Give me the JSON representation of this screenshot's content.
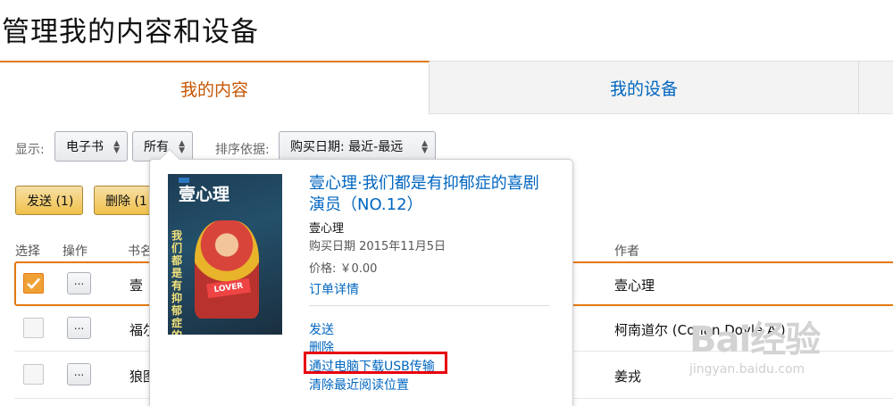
{
  "page_title": "管理我的内容和设备",
  "tabs": [
    {
      "label": "我的内容",
      "active": true
    },
    {
      "label": "我的设备",
      "active": false
    }
  ],
  "filters": {
    "show_label": "显示:",
    "type_value": "电子书",
    "scope_value": "所有",
    "sort_label": "排序依据:",
    "sort_value": "购买日期: 最近-最远"
  },
  "actions": {
    "send_label": "发送 (1)",
    "delete_label": "删除 (1"
  },
  "columns": {
    "select": "选择",
    "action": "操作",
    "title": "书名",
    "author": "作者"
  },
  "rows": [
    {
      "title": "壹",
      "author": "壹心理",
      "checked": true,
      "more": "..."
    },
    {
      "title": "福尔",
      "author": "柯南道尔 (Conan Doyle A.)",
      "checked": false,
      "more": "..."
    },
    {
      "title": "狼图",
      "author": "姜戎",
      "checked": false,
      "more": "..."
    }
  ],
  "popover": {
    "book_title": "壹心理·我们都是有抑郁症的喜剧演员（NO.12）",
    "publisher": "壹心理",
    "purchase_date": "购买日期 2015年11月5日",
    "price": "价格:  ￥0.00",
    "order_details": "订单详情",
    "send": "发送",
    "delete": "删除",
    "usb_download": "通过电脑下载USB传输",
    "clear_position": "清除最近阅读位置",
    "cover_logo": "壹心理",
    "cover_text": "我们都是有抑郁症的",
    "cover_sign": "LOVER"
  },
  "watermark": {
    "brand": "Bai经验",
    "url": "jingyan.baidu.com"
  },
  "colors": {
    "accent_orange": "#e47911",
    "link_blue": "#0066c0",
    "highlight_red": "#e8000b",
    "button_yellow": "#f0c14b"
  }
}
